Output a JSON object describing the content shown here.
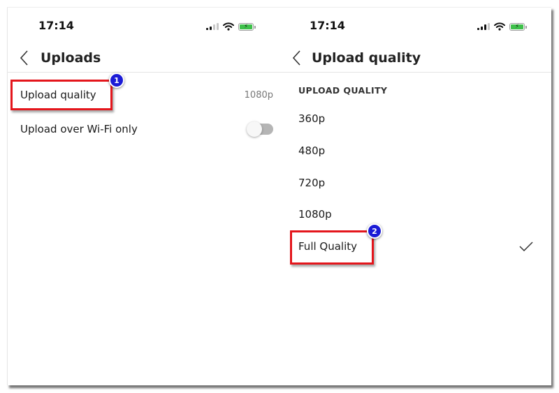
{
  "colors": {
    "highlight": "#e4161c",
    "badge": "#1b1bd6",
    "battery": "#3ec04a",
    "toggle_off": "#b5b5b5"
  },
  "left_screen": {
    "status_bar": {
      "time": "17:14",
      "icons": [
        "signal-icon",
        "wifi-icon",
        "battery-charging-icon"
      ]
    },
    "nav": {
      "back_icon": "chevron-left-icon",
      "title": "Uploads"
    },
    "rows": [
      {
        "label": "Upload quality",
        "value": "1080p"
      },
      {
        "label": "Upload over Wi-Fi only",
        "toggle": false
      }
    ],
    "annotation": {
      "badge": "1",
      "target": "Upload quality"
    }
  },
  "right_screen": {
    "status_bar": {
      "time": "17:14",
      "icons": [
        "signal-icon",
        "wifi-icon",
        "battery-charging-icon"
      ]
    },
    "nav": {
      "back_icon": "chevron-left-icon",
      "title": "Upload quality"
    },
    "section_header": "UPLOAD QUALITY",
    "options": [
      {
        "label": "360p",
        "selected": false
      },
      {
        "label": "480p",
        "selected": false
      },
      {
        "label": "720p",
        "selected": false
      },
      {
        "label": "1080p",
        "selected": false
      },
      {
        "label": "Full Quality",
        "selected": true
      }
    ],
    "annotation": {
      "badge": "2",
      "target": "Full Quality"
    }
  }
}
